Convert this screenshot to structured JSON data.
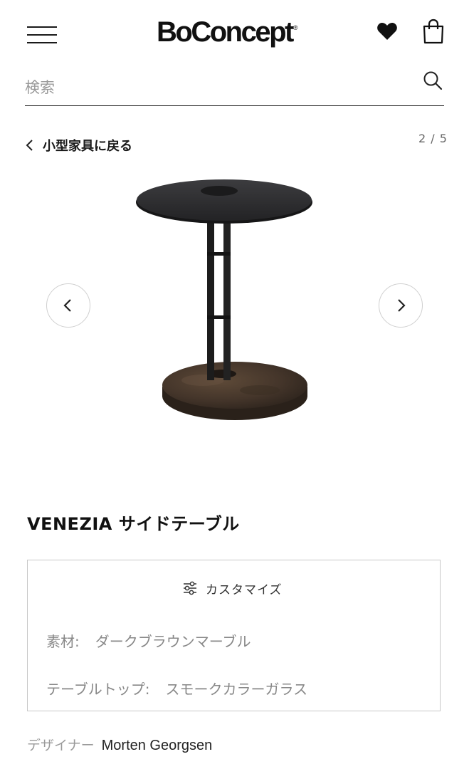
{
  "header": {
    "logo_text": "BoConcept",
    "logo_mark": "®",
    "icons": {
      "menu": "hamburger-menu-icon",
      "favorites": "heart-icon",
      "cart": "shopping-bag-icon"
    }
  },
  "search": {
    "placeholder": "検索",
    "icon": "search-icon"
  },
  "breadcrumb": {
    "back_label": "小型家具に戻る",
    "icon": "chevron-left-icon"
  },
  "gallery": {
    "pager": "2 / 5",
    "prev_icon": "chevron-left-icon",
    "next_icon": "chevron-right-icon"
  },
  "product": {
    "title": "VENEZIA サイドテーブル"
  },
  "customize": {
    "button_label": "カスタマイズ",
    "icon": "sliders-icon",
    "options": [
      {
        "key": "素材:",
        "value": "ダークブラウンマーブル"
      },
      {
        "key": "テーブルトップ:",
        "value": "スモークカラーガラス"
      }
    ]
  },
  "designer": {
    "label": "デザイナー",
    "name": "Morten Georgsen"
  },
  "colors": {
    "text": "#1a1a1a",
    "muted": "#888888",
    "border": "#c8c8c8",
    "glass": "#2e2e30",
    "marble": "#4a3a2c"
  }
}
